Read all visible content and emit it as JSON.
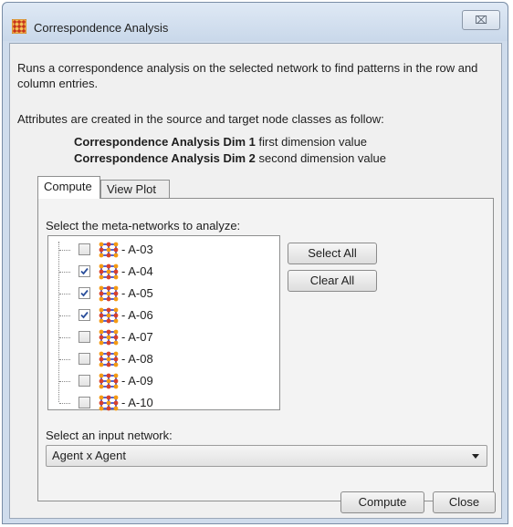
{
  "window": {
    "title": "Correspondence Analysis",
    "close_glyph": "⌧",
    "icon": "network-grid-icon"
  },
  "description": "Runs a correspondence analysis on the selected network to find patterns in the row and column entries.",
  "attributes": {
    "intro": "Attributes are created in the source and target node classes as follow:",
    "items": [
      {
        "name": "Correspondence Analysis Dim 1",
        "desc": " first dimension value"
      },
      {
        "name": "Correspondence Analysis Dim 2",
        "desc": " second dimension value"
      }
    ]
  },
  "tabs": [
    {
      "label": "Compute",
      "active": true
    },
    {
      "label": "View Plot",
      "active": false
    }
  ],
  "compute": {
    "meta_label": "Select the meta-networks to analyze:",
    "networks": [
      {
        "label": "- A-03",
        "checked": false
      },
      {
        "label": "- A-04",
        "checked": true
      },
      {
        "label": "- A-05",
        "checked": true
      },
      {
        "label": "- A-06",
        "checked": true
      },
      {
        "label": "- A-07",
        "checked": false
      },
      {
        "label": "- A-08",
        "checked": false
      },
      {
        "label": "- A-09",
        "checked": false
      },
      {
        "label": "- A-10",
        "checked": false
      }
    ],
    "select_all": "Select All",
    "clear_all": "Clear All",
    "input_label": "Select an input network:",
    "input_value": "Agent x Agent"
  },
  "footer": {
    "compute": "Compute",
    "close": "Close"
  },
  "colors": {
    "checkmark": "#2b4f9c",
    "icon_blue": "#2a3fc9",
    "icon_orange": "#f59a12",
    "icon_red": "#d9402b"
  }
}
